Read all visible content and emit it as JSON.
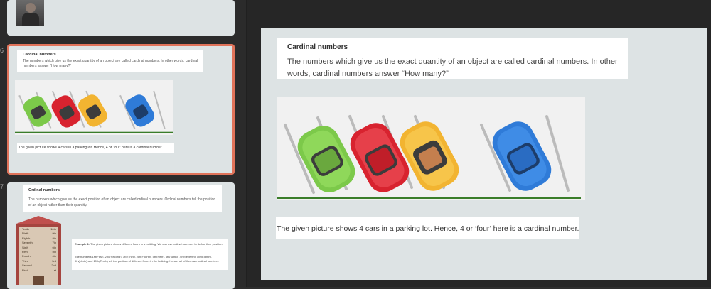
{
  "sidebar": {
    "slides": [
      {
        "number": "",
        "type": "image-only"
      },
      {
        "number": "6",
        "title": "Cardinal numbers",
        "body": "The numbers which give us the exact quantity of an object are called cardinal numbers. In other words, cardinal numbers answer “How many?”",
        "caption": "The given picture shows 4 cars in a parking lot.  Hence, 4 or ‘four’ here is a cardinal number."
      },
      {
        "number": "7",
        "title": "Ordinal numbers",
        "body": "The numbers which give us the exact position of an object are called ordinal numbers. Ordinal numbers tell the position of an object rather than their quantity.",
        "example_label": "Example 1:",
        "example_text": "The given picture shows different floors in a building. We can use ordinal numbers to define their position.",
        "example_text2": "The numbers 1st(First), 2nd(Second), 3rd(Third), 4th(Fourth), 5th(Fifth), 6th(Sixth), 7th(Seventh), 8th(Eighth), 9th(Ninth) and 10th(Tenth) tell the position of different floors in the building. Hence, all of them are ordinal numbers.",
        "floors": [
          {
            "left": "Tenth",
            "right": "10th"
          },
          {
            "left": "Ninth",
            "right": "9th"
          },
          {
            "left": "Eighth",
            "right": "8th"
          },
          {
            "left": "Seventh",
            "right": "7th"
          },
          {
            "left": "Sixth",
            "right": "6th"
          },
          {
            "left": "Fifth",
            "right": "5th"
          },
          {
            "left": "Fourth",
            "right": "4th"
          },
          {
            "left": "Third",
            "right": "3rd"
          },
          {
            "left": "Second",
            "right": "2nd"
          },
          {
            "left": "First",
            "right": "1st"
          }
        ]
      }
    ]
  },
  "main": {
    "title": "Cardinal numbers",
    "body": "The numbers which give us the exact quantity of an object are called cardinal numbers. In other words, cardinal numbers answer “How many?”",
    "caption": "The given picture shows 4 cars in a parking lot.  Hence, 4 or ‘four’ here is a cardinal number."
  },
  "colors": {
    "active_border": "#e0735a",
    "car_green": "#7cc94a",
    "car_red": "#d8232f",
    "car_yellow": "#f2b431",
    "car_blue": "#2f7bd8",
    "ground": "#3a7d2a"
  }
}
